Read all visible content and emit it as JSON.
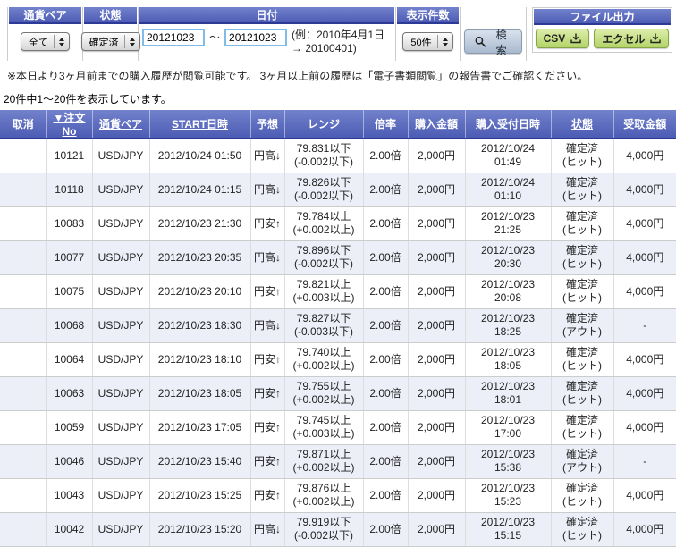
{
  "colors": {
    "header_blue_top": "#7282cc",
    "header_blue_bottom": "#4d5cb4",
    "header_border": "#2c3a96",
    "row_stripe": "#edeff8",
    "button_green_top": "#dcedaa",
    "button_green_bottom": "#b3d468",
    "input_border": "#7fbde8"
  },
  "filters": {
    "currency_pair": {
      "label": "通貨ペア",
      "value": "全て"
    },
    "status": {
      "label": "状態",
      "value": "確定済"
    },
    "date": {
      "label": "日付",
      "from": "20121023",
      "separator": "〜",
      "to": "20121023",
      "example": "(例：2010年4月1日 → 20100401)"
    },
    "display_count": {
      "label": "表示件数",
      "value": "50件"
    },
    "search_label": "検索"
  },
  "file_output": {
    "label": "ファイル出力",
    "csv_label": "CSV",
    "excel_label": "エクセル"
  },
  "notes": {
    "history_note": "※本日より3ヶ月前までの購入履歴が閲覧可能です。 3ヶ月以上前の履歴は「電子書類閲覧」の報告書でご確認ください。",
    "result_count": "20件中1〜20件を表示しています。"
  },
  "table": {
    "headers": [
      {
        "key": "cancel",
        "label": "取消",
        "sortable": false
      },
      {
        "key": "order_no",
        "label": "▼注文No",
        "sortable": true
      },
      {
        "key": "currency_pair",
        "label": "通貨ペア",
        "sortable": true
      },
      {
        "key": "start_datetime",
        "label": "START日時",
        "sortable": true
      },
      {
        "key": "forecast",
        "label": "予想",
        "sortable": false
      },
      {
        "key": "range",
        "label": "レンジ",
        "sortable": false
      },
      {
        "key": "rate",
        "label": "倍率",
        "sortable": false
      },
      {
        "key": "amount",
        "label": "購入金額",
        "sortable": false
      },
      {
        "key": "accepted",
        "label": "購入受付日時",
        "sortable": false
      },
      {
        "key": "status",
        "label": "状態",
        "sortable": true
      },
      {
        "key": "payout",
        "label": "受取金額",
        "sortable": false
      }
    ],
    "rows": [
      {
        "order_no": "10121",
        "pair": "USD/JPY",
        "start": "2012/10/24 01:50",
        "forecast": "円高↓",
        "range_line1": "79.831以下",
        "range_line2": "(-0.002以下)",
        "rate": "2.00倍",
        "amount": "2,000円",
        "accepted": "2012/10/24 01:49",
        "status_line1": "確定済",
        "status_line2": "(ヒット)",
        "payout": "4,000円"
      },
      {
        "order_no": "10118",
        "pair": "USD/JPY",
        "start": "2012/10/24 01:15",
        "forecast": "円高↓",
        "range_line1": "79.826以下",
        "range_line2": "(-0.002以下)",
        "rate": "2.00倍",
        "amount": "2,000円",
        "accepted": "2012/10/24 01:10",
        "status_line1": "確定済",
        "status_line2": "(ヒット)",
        "payout": "4,000円"
      },
      {
        "order_no": "10083",
        "pair": "USD/JPY",
        "start": "2012/10/23 21:30",
        "forecast": "円安↑",
        "range_line1": "79.784以上",
        "range_line2": "(+0.002以上)",
        "rate": "2.00倍",
        "amount": "2,000円",
        "accepted": "2012/10/23 21:25",
        "status_line1": "確定済",
        "status_line2": "(ヒット)",
        "payout": "4,000円"
      },
      {
        "order_no": "10077",
        "pair": "USD/JPY",
        "start": "2012/10/23 20:35",
        "forecast": "円高↓",
        "range_line1": "79.896以下",
        "range_line2": "(-0.002以下)",
        "rate": "2.00倍",
        "amount": "2,000円",
        "accepted": "2012/10/23 20:30",
        "status_line1": "確定済",
        "status_line2": "(ヒット)",
        "payout": "4,000円"
      },
      {
        "order_no": "10075",
        "pair": "USD/JPY",
        "start": "2012/10/23 20:10",
        "forecast": "円安↑",
        "range_line1": "79.821以上",
        "range_line2": "(+0.003以上)",
        "rate": "2.00倍",
        "amount": "2,000円",
        "accepted": "2012/10/23 20:08",
        "status_line1": "確定済",
        "status_line2": "(ヒット)",
        "payout": "4,000円"
      },
      {
        "order_no": "10068",
        "pair": "USD/JPY",
        "start": "2012/10/23 18:30",
        "forecast": "円高↓",
        "range_line1": "79.827以下",
        "range_line2": "(-0.003以下)",
        "rate": "2.00倍",
        "amount": "2,000円",
        "accepted": "2012/10/23 18:25",
        "status_line1": "確定済",
        "status_line2": "(アウト)",
        "payout": "-"
      },
      {
        "order_no": "10064",
        "pair": "USD/JPY",
        "start": "2012/10/23 18:10",
        "forecast": "円安↑",
        "range_line1": "79.740以上",
        "range_line2": "(+0.002以上)",
        "rate": "2.00倍",
        "amount": "2,000円",
        "accepted": "2012/10/23 18:05",
        "status_line1": "確定済",
        "status_line2": "(ヒット)",
        "payout": "4,000円"
      },
      {
        "order_no": "10063",
        "pair": "USD/JPY",
        "start": "2012/10/23 18:05",
        "forecast": "円安↑",
        "range_line1": "79.755以上",
        "range_line2": "(+0.002以上)",
        "rate": "2.00倍",
        "amount": "2,000円",
        "accepted": "2012/10/23 18:01",
        "status_line1": "確定済",
        "status_line2": "(ヒット)",
        "payout": "4,000円"
      },
      {
        "order_no": "10059",
        "pair": "USD/JPY",
        "start": "2012/10/23 17:05",
        "forecast": "円安↑",
        "range_line1": "79.745以上",
        "range_line2": "(+0.003以上)",
        "rate": "2.00倍",
        "amount": "2,000円",
        "accepted": "2012/10/23 17:00",
        "status_line1": "確定済",
        "status_line2": "(ヒット)",
        "payout": "4,000円"
      },
      {
        "order_no": "10046",
        "pair": "USD/JPY",
        "start": "2012/10/23 15:40",
        "forecast": "円安↑",
        "range_line1": "79.871以上",
        "range_line2": "(+0.002以上)",
        "rate": "2.00倍",
        "amount": "2,000円",
        "accepted": "2012/10/23 15:38",
        "status_line1": "確定済",
        "status_line2": "(アウト)",
        "payout": "-"
      },
      {
        "order_no": "10043",
        "pair": "USD/JPY",
        "start": "2012/10/23 15:25",
        "forecast": "円安↑",
        "range_line1": "79.876以上",
        "range_line2": "(+0.002以上)",
        "rate": "2.00倍",
        "amount": "2,000円",
        "accepted": "2012/10/23 15:23",
        "status_line1": "確定済",
        "status_line2": "(ヒット)",
        "payout": "4,000円"
      },
      {
        "order_no": "10042",
        "pair": "USD/JPY",
        "start": "2012/10/23 15:20",
        "forecast": "円高↓",
        "range_line1": "79.919以下",
        "range_line2": "(-0.002以下)",
        "rate": "2.00倍",
        "amount": "2,000円",
        "accepted": "2012/10/23 15:15",
        "status_line1": "確定済",
        "status_line2": "(ヒット)",
        "payout": "4,000円"
      }
    ]
  }
}
